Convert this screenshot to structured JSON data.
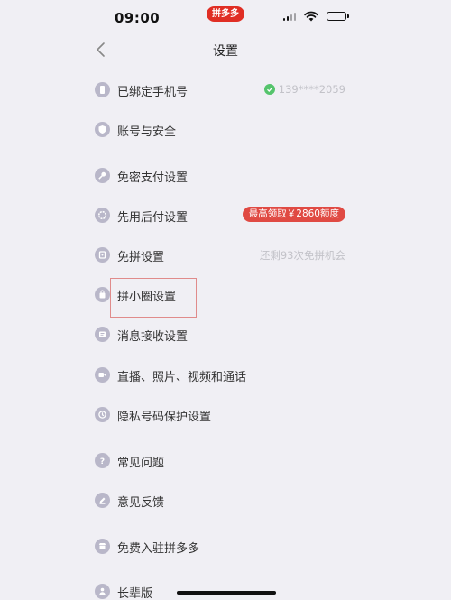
{
  "status_bar": {
    "time": "09:00",
    "app_badge": "拼多多"
  },
  "nav": {
    "title": "设置"
  },
  "settings": {
    "items": [
      {
        "label": "已绑定手机号",
        "icon": "phone-icon",
        "right_text": "139****2059"
      },
      {
        "label": "账号与安全",
        "icon": "shield-icon"
      },
      {
        "label": "免密支付设置",
        "icon": "key-icon"
      },
      {
        "label": "先用后付设置",
        "icon": "badge-icon",
        "promo": "最高领取￥2860额度"
      },
      {
        "label": "免拼设置",
        "icon": "ticket-icon",
        "right_text": "还剩93次免拼机会"
      },
      {
        "label": "拼小圈设置",
        "icon": "bag-icon"
      },
      {
        "label": "消息接收设置",
        "icon": "message-icon"
      },
      {
        "label": "直播、照片、视频和通话",
        "icon": "video-icon"
      },
      {
        "label": "隐私号码保护设置",
        "icon": "privacy-icon"
      },
      {
        "label": "常见问题",
        "icon": "question-icon"
      },
      {
        "label": "意见反馈",
        "icon": "pencil-icon"
      },
      {
        "label": "免费入驻拼多多",
        "icon": "store-icon"
      },
      {
        "label": "长辈版",
        "icon": "person-icon"
      }
    ]
  },
  "colors": {
    "background": "#f0eff4",
    "icon": "#b9b7c9",
    "brand_red": "#e02e24",
    "verified_green": "#55c46c"
  }
}
